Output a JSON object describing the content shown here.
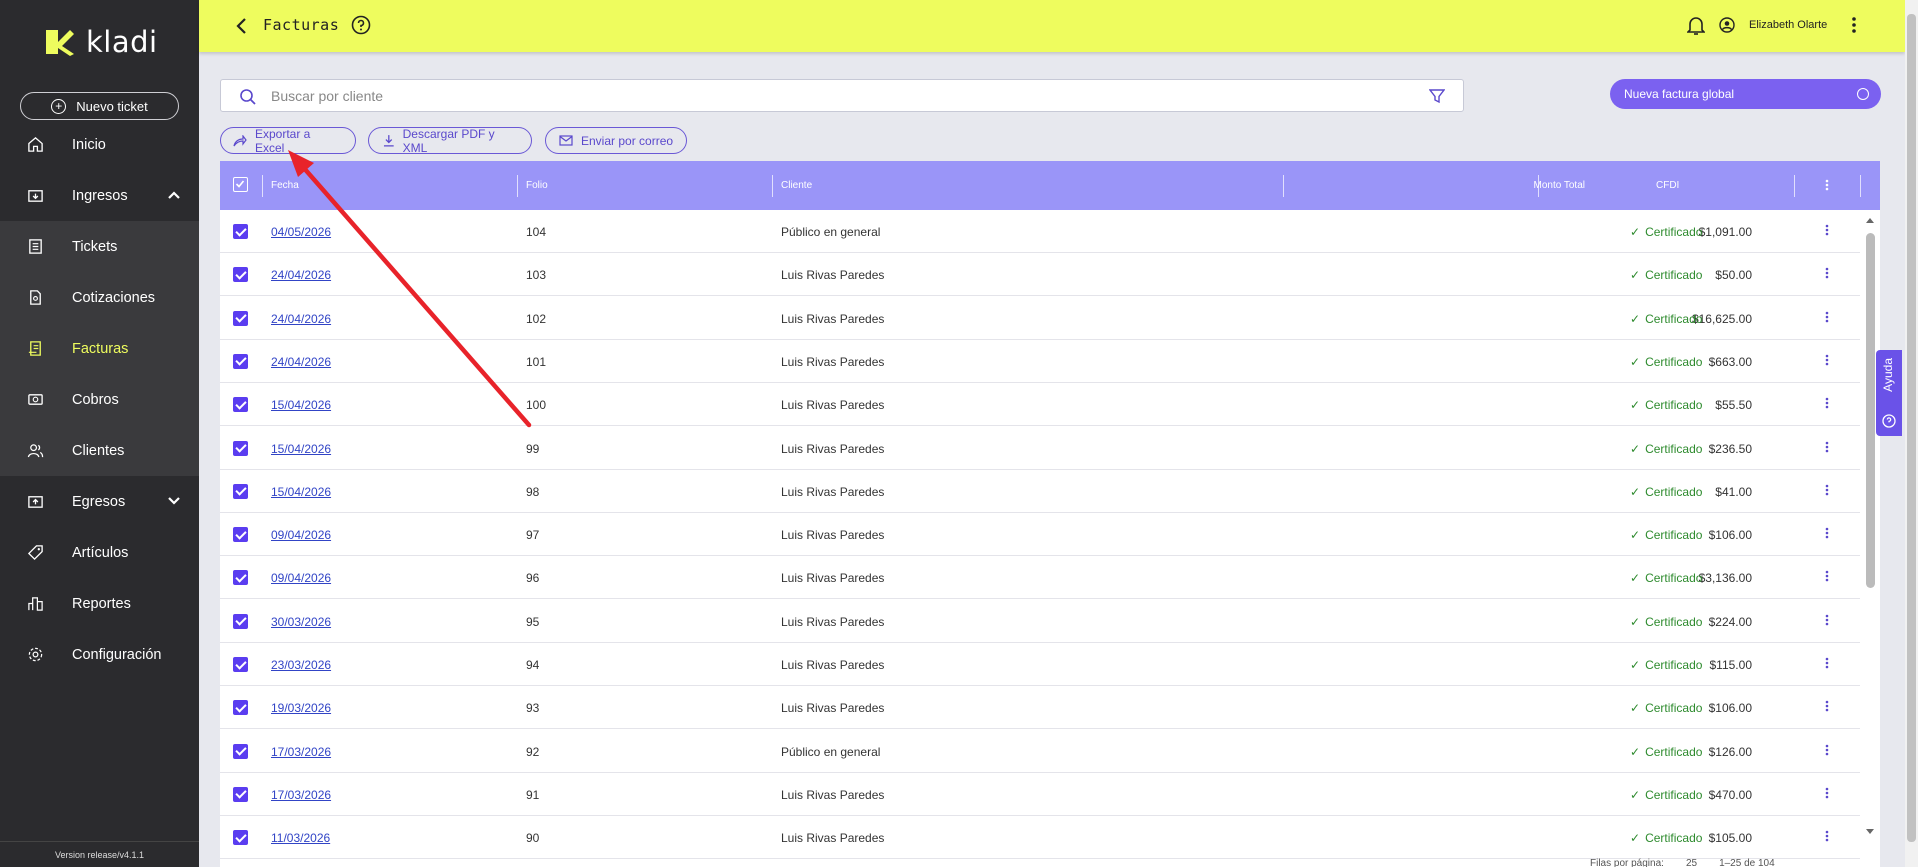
{
  "app": {
    "brand": "kladi",
    "version": "Version release/v4.1.1"
  },
  "sidebar": {
    "new_ticket": "Nuevo ticket",
    "items": [
      {
        "label": "Inicio",
        "icon": "home-icon"
      },
      {
        "label": "Ingresos",
        "icon": "income-icon"
      },
      {
        "label": "Tickets",
        "icon": "ticket-icon"
      },
      {
        "label": "Cotizaciones",
        "icon": "quote-icon"
      },
      {
        "label": "Facturas",
        "icon": "invoice-icon"
      },
      {
        "label": "Cobros",
        "icon": "payments-icon"
      },
      {
        "label": "Clientes",
        "icon": "clients-icon"
      },
      {
        "label": "Egresos",
        "icon": "expenses-icon"
      },
      {
        "label": "Artículos",
        "icon": "tag-icon"
      },
      {
        "label": "Reportes",
        "icon": "reports-icon"
      },
      {
        "label": "Configuración",
        "icon": "gear-icon"
      }
    ]
  },
  "header": {
    "title": "Facturas",
    "user": "Elizabeth Olarte"
  },
  "search": {
    "placeholder": "Buscar por cliente"
  },
  "global_invoice_button": "Nueva factura global",
  "actions": {
    "export": "Exportar a Excel",
    "download": "Descargar PDF y XML",
    "email": "Enviar por correo"
  },
  "table": {
    "columns": {
      "fecha": "Fecha",
      "folio": "Folio",
      "cliente": "Cliente",
      "monto": "Monto Total",
      "cfdi": "CFDI"
    },
    "rows": [
      {
        "fecha": "04/05/2026",
        "folio": "104",
        "cliente": "Público en general",
        "monto": "$1,091.00",
        "cfdi": "Certificado"
      },
      {
        "fecha": "24/04/2026",
        "folio": "103",
        "cliente": "Luis Rivas Paredes",
        "monto": "$50.00",
        "cfdi": "Certificado"
      },
      {
        "fecha": "24/04/2026",
        "folio": "102",
        "cliente": "Luis Rivas Paredes",
        "monto": "$16,625.00",
        "cfdi": "Certificado"
      },
      {
        "fecha": "24/04/2026",
        "folio": "101",
        "cliente": "Luis Rivas Paredes",
        "monto": "$663.00",
        "cfdi": "Certificado"
      },
      {
        "fecha": "15/04/2026",
        "folio": "100",
        "cliente": "Luis Rivas Paredes",
        "monto": "$55.50",
        "cfdi": "Certificado"
      },
      {
        "fecha": "15/04/2026",
        "folio": "99",
        "cliente": "Luis Rivas Paredes",
        "monto": "$236.50",
        "cfdi": "Certificado"
      },
      {
        "fecha": "15/04/2026",
        "folio": "98",
        "cliente": "Luis Rivas Paredes",
        "monto": "$41.00",
        "cfdi": "Certificado"
      },
      {
        "fecha": "09/04/2026",
        "folio": "97",
        "cliente": "Luis Rivas Paredes",
        "monto": "$106.00",
        "cfdi": "Certificado"
      },
      {
        "fecha": "09/04/2026",
        "folio": "96",
        "cliente": "Luis Rivas Paredes",
        "monto": "$3,136.00",
        "cfdi": "Certificado"
      },
      {
        "fecha": "30/03/2026",
        "folio": "95",
        "cliente": "Luis Rivas Paredes",
        "monto": "$224.00",
        "cfdi": "Certificado"
      },
      {
        "fecha": "23/03/2026",
        "folio": "94",
        "cliente": "Luis Rivas Paredes",
        "monto": "$115.00",
        "cfdi": "Certificado"
      },
      {
        "fecha": "19/03/2026",
        "folio": "93",
        "cliente": "Luis Rivas Paredes",
        "monto": "$106.00",
        "cfdi": "Certificado"
      },
      {
        "fecha": "17/03/2026",
        "folio": "92",
        "cliente": "Público en general",
        "monto": "$126.00",
        "cfdi": "Certificado"
      },
      {
        "fecha": "17/03/2026",
        "folio": "91",
        "cliente": "Luis Rivas Paredes",
        "monto": "$470.00",
        "cfdi": "Certificado"
      },
      {
        "fecha": "11/03/2026",
        "folio": "90",
        "cliente": "Luis Rivas Paredes",
        "monto": "$105.00",
        "cfdi": "Certificado"
      }
    ]
  },
  "pagination": {
    "rows_per_page_label": "Filas por página:",
    "rows_per_page": "25",
    "range": "1–25 de 104"
  },
  "help_tab": "Ayuda",
  "colors": {
    "accent": "#7b61f0",
    "topbar": "#eefc5e",
    "sidebar": "#2b2b2e",
    "success": "#2e8b2e",
    "annotation": "#e8232a"
  }
}
